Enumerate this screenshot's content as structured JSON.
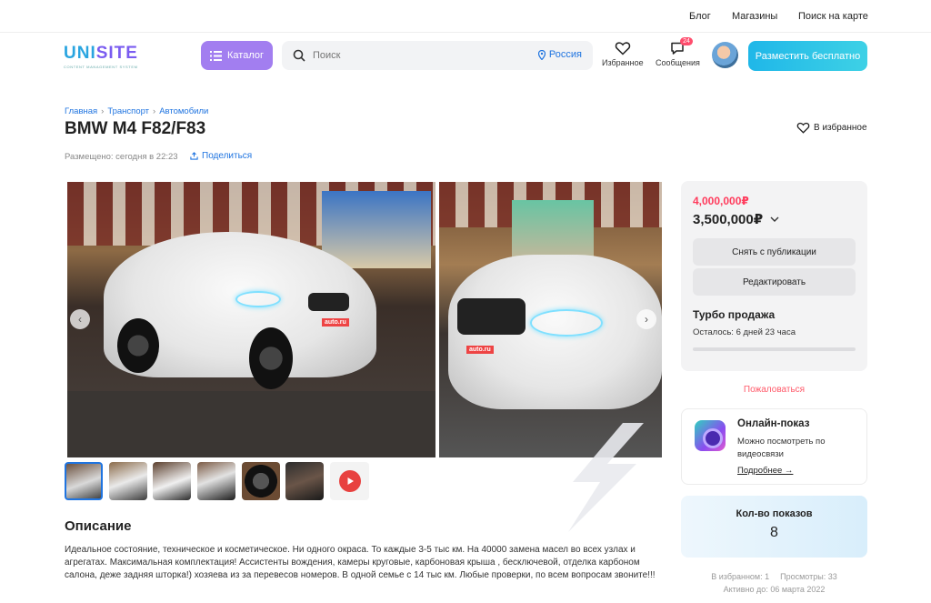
{
  "topbar": {
    "links": [
      "Блог",
      "Магазины",
      "Поиск на карте"
    ]
  },
  "logo": {
    "text_a": "UNI",
    "text_b": "SITE",
    "tagline": "CONTENT MANAGEMENT SYSTEM"
  },
  "header": {
    "catalog_label": "Каталог",
    "search_placeholder": "Поиск",
    "region": "Россия",
    "favorites_label": "Избранное",
    "messages_label": "Сообщения",
    "messages_count": "24",
    "post_button": "Разместить бесплатно"
  },
  "breadcrumbs": [
    "Главная",
    "Транспорт",
    "Автомобили"
  ],
  "listing": {
    "title": "BMW M4 F82/F83",
    "fav_label": "В избранное",
    "posted": "Размещено: сегодня в 22:23",
    "share_label": "Поделиться"
  },
  "gallery": {
    "plate_text": "auto.ru",
    "thumb_count": 6,
    "selected_thumb": 0
  },
  "description": {
    "title": "Описание",
    "text": "Идеальное состояние, техническое и косметическое. Ни одного окраса. То каждые 3-5 тыс км. На 40000 замена масел во всех узлах и агрегатах. Максимальная комплектация! Ассистенты вождения, камеры круговые, карбоновая крыша , бесключевой, отделка карбоном салона, деже задняя шторка!) хозяева из за перевесов номеров. В одной семье с 14 тыс км. Любые проверки, по всем вопросам звоните!!!"
  },
  "price_card": {
    "old_price": "4,000,000₽",
    "price": "3,500,000₽",
    "unpublish_label": "Снять с публикации",
    "edit_label": "Редактировать",
    "turbo_title": "Турбо продажа",
    "remaining": "Осталось: 6 дней 23 часа",
    "turbo_progress": 0.0
  },
  "report_label": "Пожаловаться",
  "online_show": {
    "title": "Онлайн-показ",
    "text": "Можно посмотреть по видеосвязи",
    "more": "Подробнее →"
  },
  "views": {
    "title": "Кол-во показов",
    "count": "8"
  },
  "stats": {
    "in_favorites": "В избранном: 1",
    "views": "Просмотры: 33",
    "active_until": "Активно до: 06 марта 2022"
  },
  "colors": {
    "accent": "#1f74e0",
    "catalog": "#a27ef0",
    "cta": "#1fb7e8",
    "alert": "#ff3b5c"
  }
}
